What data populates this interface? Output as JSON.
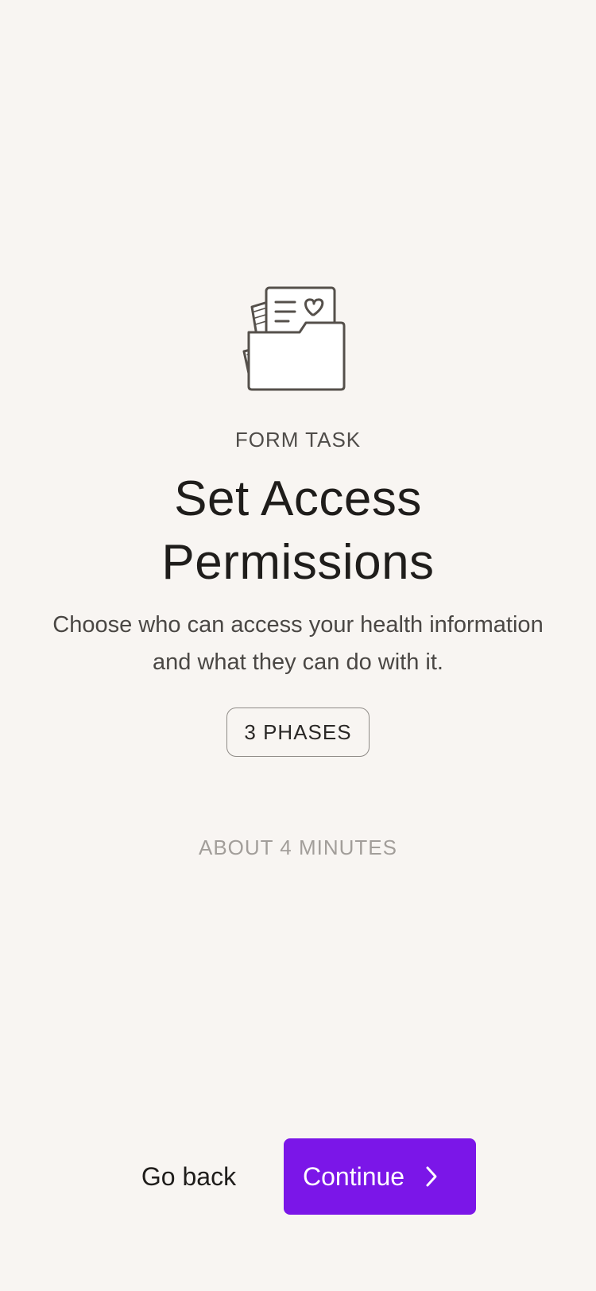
{
  "header": {
    "illustration_icon": "folder-with-heart-document-icon",
    "eyebrow": "FORM TASK",
    "title": "Set Access Permissions",
    "description": "Choose who can access your health information and what they can do with it."
  },
  "meta": {
    "phases": "3 PHASES",
    "duration": "ABOUT 4 MINUTES"
  },
  "actions": {
    "back_label": "Go back",
    "continue_label": "Continue",
    "continue_icon": "chevron-right-icon"
  },
  "colors": {
    "background": "#f8f5f2",
    "primary": "#7b16e8",
    "text": "#1f1d1b",
    "muted": "#a29e9a"
  }
}
